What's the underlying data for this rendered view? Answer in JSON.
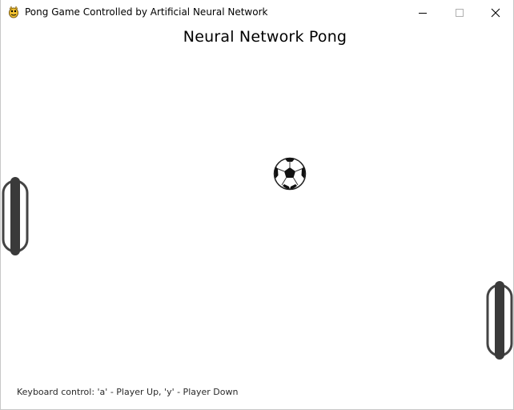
{
  "window": {
    "title": "Pong Game Controlled by Artificial Neural Network",
    "icon": "pygame-snake-icon",
    "buttons": {
      "minimize": "minimize-icon",
      "maximize": "maximize-icon",
      "close": "close-icon"
    }
  },
  "game": {
    "heading": "Neural Network Pong",
    "ball": "soccer-ball",
    "left_paddle": "paddle",
    "right_paddle": "paddle",
    "footer": "Keyboard control: 'a' - Player Up, 'y' - Player Down"
  },
  "colors": {
    "background": "#ffffff",
    "paddle_dark": "#3a3a3a",
    "text": "#000000"
  }
}
